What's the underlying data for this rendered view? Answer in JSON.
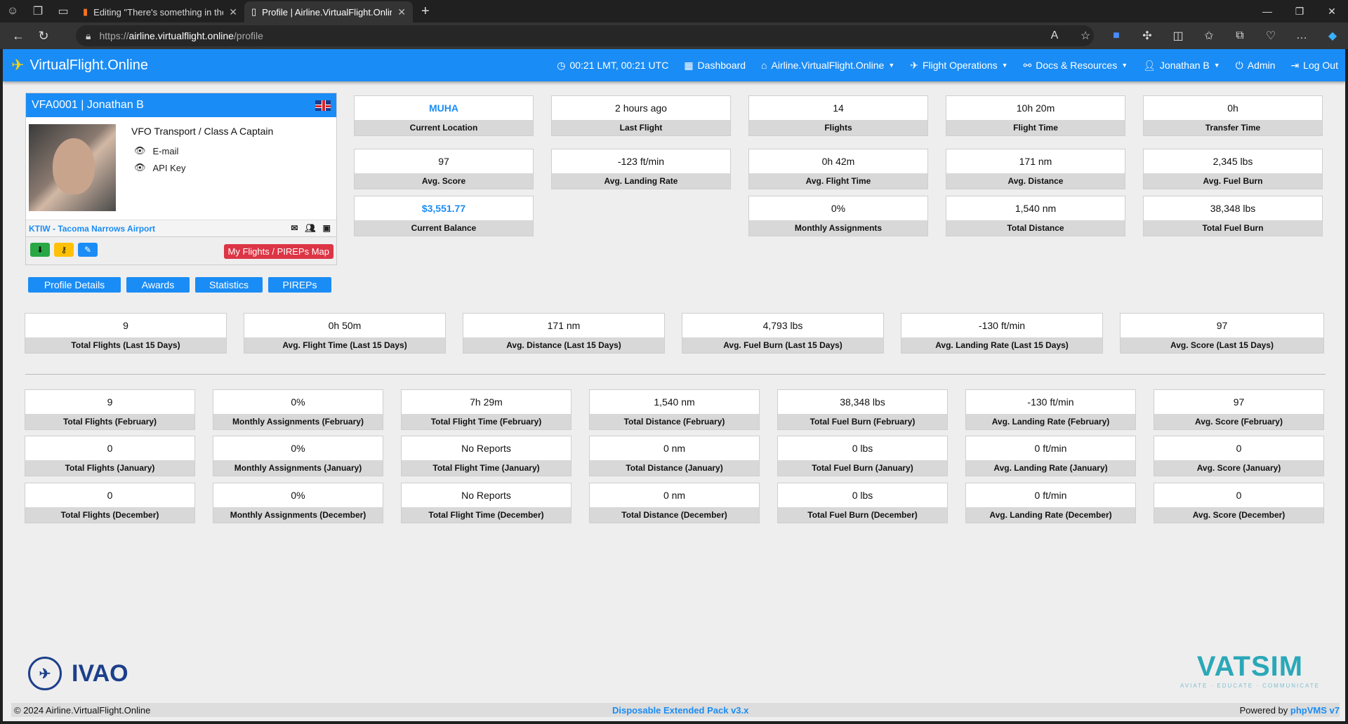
{
  "browser": {
    "tabs": [
      {
        "title": "Editing \"There's something in the"
      },
      {
        "title": "Profile | Airline.VirtualFlight.Online"
      }
    ],
    "url_scheme": "https://",
    "url_host": "airline.virtualflight.online",
    "url_path": "/profile"
  },
  "nav": {
    "brand": "VirtualFlight.Online",
    "time": "00:21 LMT, 00:21 UTC",
    "items": [
      "Dashboard",
      "Airline.VirtualFlight.Online",
      "Flight Operations",
      "Docs & Resources",
      "Jonathan B",
      "Admin",
      "Log Out"
    ]
  },
  "profile": {
    "header": "VFA0001 | Jonathan B",
    "rank": "VFO Transport / Class A Captain",
    "email_label": "E-mail",
    "api_label": "API Key",
    "airport": "KTIW - Tacoma Narrows Airport",
    "map_button": "My Flights / PIREPs Map",
    "tabs": [
      "Profile Details",
      "Awards",
      "Statistics",
      "PIREPs"
    ]
  },
  "summary": [
    {
      "value": "MUHA",
      "label": "Current Location"
    },
    {
      "value": "2 hours ago",
      "label": "Last Flight"
    },
    {
      "value": "14",
      "label": "Flights"
    },
    {
      "value": "10h 20m",
      "label": "Flight Time"
    },
    {
      "value": "0h",
      "label": "Transfer Time"
    },
    {
      "value": "97",
      "label": "Avg. Score"
    },
    {
      "value": "-123 ft/min",
      "label": "Avg. Landing Rate"
    },
    {
      "value": "0h 42m",
      "label": "Avg. Flight Time"
    },
    {
      "value": "171 nm",
      "label": "Avg. Distance"
    },
    {
      "value": "2,345 lbs",
      "label": "Avg. Fuel Burn"
    },
    {
      "value": "$3,551.77",
      "label": "Current Balance"
    },
    {
      "value": "0%",
      "label": "Monthly Assignments"
    },
    {
      "value": "1,540 nm",
      "label": "Total Distance"
    },
    {
      "value": "38,348 lbs",
      "label": "Total Fuel Burn"
    }
  ],
  "last15": [
    {
      "value": "9",
      "label": "Total Flights (Last 15 Days)"
    },
    {
      "value": "0h 50m",
      "label": "Avg. Flight Time (Last 15 Days)"
    },
    {
      "value": "171 nm",
      "label": "Avg. Distance (Last 15 Days)"
    },
    {
      "value": "4,793 lbs",
      "label": "Avg. Fuel Burn (Last 15 Days)"
    },
    {
      "value": "-130 ft/min",
      "label": "Avg. Landing Rate (Last 15 Days)"
    },
    {
      "value": "97",
      "label": "Avg. Score (Last 15 Days)"
    }
  ],
  "monthly": [
    {
      "value": "9",
      "label": "Total Flights (February)"
    },
    {
      "value": "0%",
      "label": "Monthly Assignments (February)"
    },
    {
      "value": "7h 29m",
      "label": "Total Flight Time (February)"
    },
    {
      "value": "1,540 nm",
      "label": "Total Distance (February)"
    },
    {
      "value": "38,348 lbs",
      "label": "Total Fuel Burn (February)"
    },
    {
      "value": "-130 ft/min",
      "label": "Avg. Landing Rate (February)"
    },
    {
      "value": "97",
      "label": "Avg. Score (February)"
    },
    {
      "value": "0",
      "label": "Total Flights (January)"
    },
    {
      "value": "0%",
      "label": "Monthly Assignments (January)"
    },
    {
      "value": "No Reports",
      "label": "Total Flight Time (January)"
    },
    {
      "value": "0 nm",
      "label": "Total Distance (January)"
    },
    {
      "value": "0 lbs",
      "label": "Total Fuel Burn (January)"
    },
    {
      "value": "0 ft/min",
      "label": "Avg. Landing Rate (January)"
    },
    {
      "value": "0",
      "label": "Avg. Score (January)"
    },
    {
      "value": "0",
      "label": "Total Flights (December)"
    },
    {
      "value": "0%",
      "label": "Monthly Assignments (December)"
    },
    {
      "value": "No Reports",
      "label": "Total Flight Time (December)"
    },
    {
      "value": "0 nm",
      "label": "Total Distance (December)"
    },
    {
      "value": "0 lbs",
      "label": "Total Fuel Burn (December)"
    },
    {
      "value": "0 ft/min",
      "label": "Avg. Landing Rate (December)"
    },
    {
      "value": "0",
      "label": "Avg. Score (December)"
    }
  ],
  "logos": {
    "ivao": "IVAO",
    "vatsim": "VATSIM",
    "vatsim_tagline": "AVIATE · EDUCATE · COMMUNICATE"
  },
  "footer": {
    "copyright": "© 2024 Airline.VirtualFlight.Online",
    "center": "Disposable Extended Pack v3.x",
    "powered": "Powered by",
    "powered_link": "phpVMS v7"
  }
}
